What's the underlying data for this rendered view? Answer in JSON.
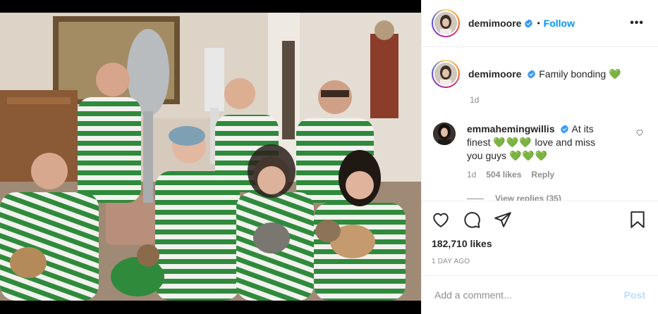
{
  "photo": {
    "alt": "",
    "colors": {
      "stripe_green": "#2f8a3c",
      "wall": "#d8cfc4",
      "spoon": "#b8bcbf"
    }
  },
  "header": {
    "username": "demimoore",
    "separator": "•",
    "follow_label": "Follow",
    "more_label": "•••"
  },
  "caption": {
    "username": "demimoore",
    "text": "Family bonding",
    "emoji": "💚",
    "time": "1d"
  },
  "comment": {
    "username": "emmahemingwillis",
    "text_before": "At its finest",
    "hearts_1": "💚💚💚",
    "text_after": "love and miss you guys",
    "hearts_2": "💚💚💚",
    "time": "1d",
    "likes": "504 likes",
    "reply_label": "Reply",
    "view_replies": "View replies (35)"
  },
  "actions": {
    "likes": "182,710 likes",
    "timestamp": "1 DAY AGO"
  },
  "add_comment": {
    "placeholder": "Add a comment...",
    "post_label": "Post"
  },
  "colors": {
    "accent": "#0095f6",
    "verified": "#3897f0",
    "muted": "#8e8e8e",
    "heart_green": "#00c200",
    "post_disabled": "#b2dffc"
  }
}
